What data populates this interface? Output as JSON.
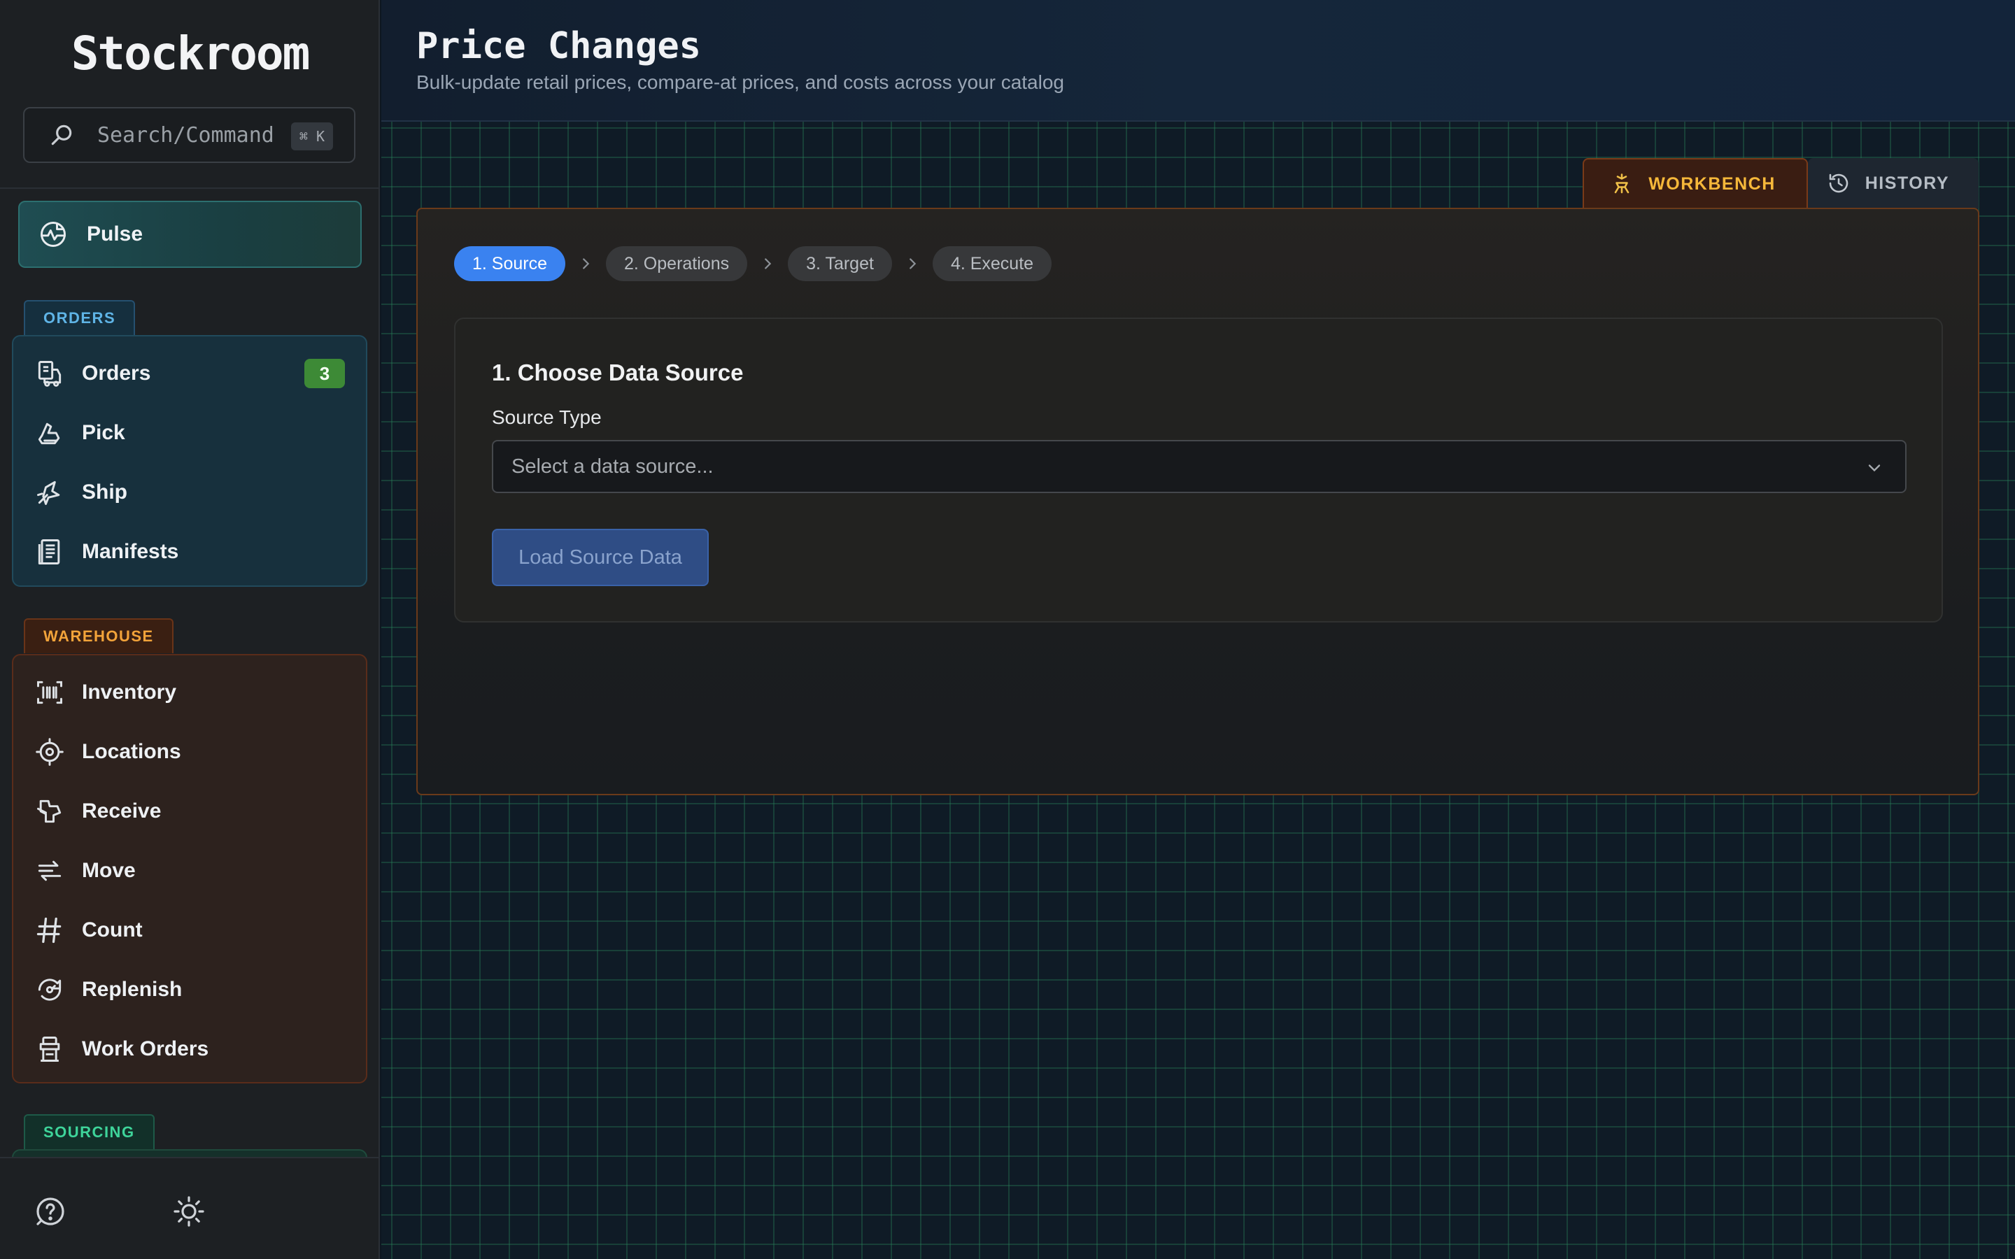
{
  "app": {
    "brand": "Stockroom"
  },
  "search": {
    "placeholder": "Search/Command",
    "shortcut": "⌘ K"
  },
  "sidebar": {
    "pulse": {
      "label": "Pulse",
      "icon": "pulse-icon"
    },
    "sections": {
      "orders": {
        "tag": "ORDERS",
        "items": [
          {
            "label": "Orders",
            "icon": "orders-icon",
            "badge": "3"
          },
          {
            "label": "Pick",
            "icon": "pick-icon"
          },
          {
            "label": "Ship",
            "icon": "ship-icon"
          },
          {
            "label": "Manifests",
            "icon": "manifests-icon"
          }
        ]
      },
      "warehouse": {
        "tag": "WAREHOUSE",
        "items": [
          {
            "label": "Inventory",
            "icon": "barcode-icon"
          },
          {
            "label": "Locations",
            "icon": "target-icon"
          },
          {
            "label": "Receive",
            "icon": "receive-icon"
          },
          {
            "label": "Move",
            "icon": "move-icon"
          },
          {
            "label": "Count",
            "icon": "hash-icon"
          },
          {
            "label": "Replenish",
            "icon": "replenish-icon"
          },
          {
            "label": "Work Orders",
            "icon": "work-orders-icon"
          }
        ]
      },
      "sourcing": {
        "tag": "SOURCING"
      }
    },
    "footer": {
      "help_icon": "help-icon",
      "theme_icon": "sun-icon"
    }
  },
  "header": {
    "title": "Price Changes",
    "subtitle": "Bulk-update retail prices, compare-at prices, and costs across your catalog"
  },
  "tabs": [
    {
      "label": "WORKBENCH",
      "icon": "workbench-icon",
      "active": true
    },
    {
      "label": "HISTORY",
      "icon": "history-icon",
      "active": false
    }
  ],
  "wizard": {
    "steps": [
      "1. Source",
      "2. Operations",
      "3. Target",
      "4. Execute"
    ],
    "active_step": 1,
    "panel_title": "1. Choose Data Source",
    "source_label": "Source Type",
    "source_placeholder": "Select a data source...",
    "load_button": "Load Source Data"
  },
  "colors": {
    "accent_blue": "#3a82f0",
    "orders_accent": "#5fb4e6",
    "warehouse_accent": "#f2a33a",
    "sourcing_accent": "#3ed49a",
    "badge_green": "#3d8a36"
  }
}
